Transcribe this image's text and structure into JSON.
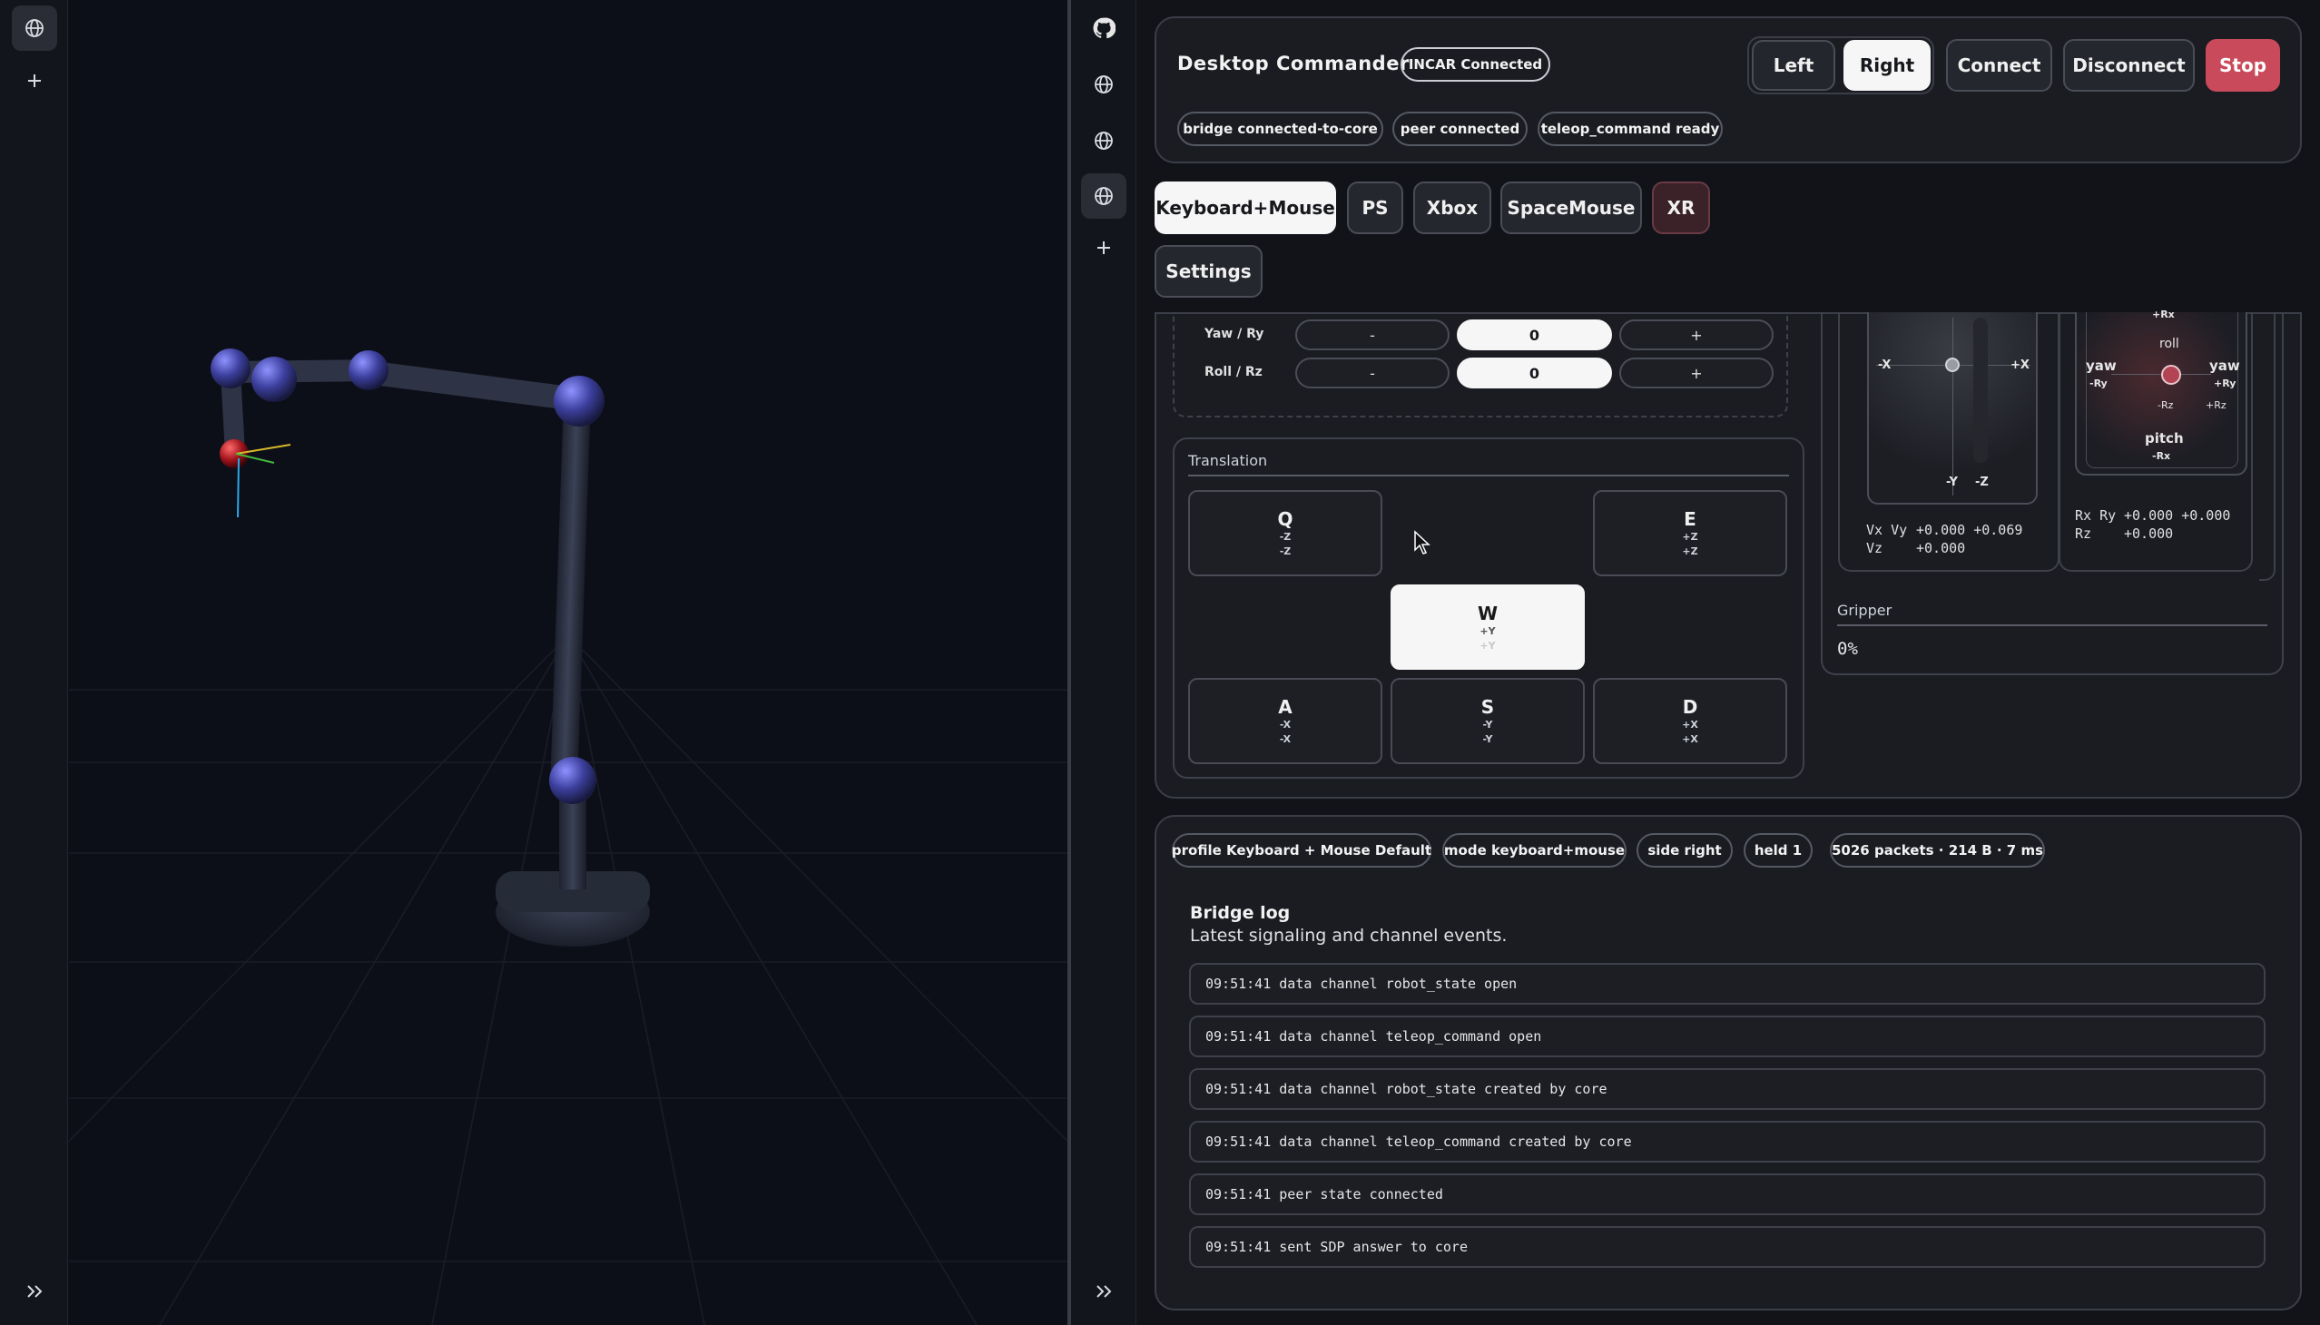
{
  "app": {
    "title": "Desktop Commander",
    "connection_badge": "INCAR Connected",
    "status_chips": [
      "bridge connected-to-core",
      "peer connected",
      "teleop_command ready"
    ]
  },
  "side_toggle": {
    "left": "Left",
    "right": "Right",
    "selected": "Right"
  },
  "actions": {
    "connect": "Connect",
    "disconnect": "Disconnect",
    "stop": "Stop"
  },
  "modes": {
    "keyboard": "Keyboard+Mouse",
    "ps": "PS",
    "xbox": "Xbox",
    "spacemouse": "SpaceMouse",
    "xr": "XR",
    "settings": "Settings",
    "selected": "Keyboard+Mouse"
  },
  "rotation": {
    "rows": [
      {
        "label": "Yaw / Ry",
        "minus": "-",
        "value": "0",
        "plus": "+"
      },
      {
        "label": "Roll / Rz",
        "minus": "-",
        "value": "0",
        "plus": "+"
      }
    ]
  },
  "translation": {
    "title": "Translation",
    "keys": {
      "q": {
        "key": "Q",
        "l1": "-Z",
        "l2": "-Z"
      },
      "e": {
        "key": "E",
        "l1": "+Z",
        "l2": "+Z"
      },
      "w": {
        "key": "W",
        "l1": "+Y",
        "l2": "+Y",
        "pressed": true
      },
      "a": {
        "key": "A",
        "l1": "-X",
        "l2": "-X"
      },
      "s": {
        "key": "S",
        "l1": "-Y",
        "l2": "-Y"
      },
      "d": {
        "key": "D",
        "l1": "+X",
        "l2": "+X"
      }
    }
  },
  "stick_left": {
    "neg_x": "-X",
    "pos_x": "+X",
    "neg_y": "-Y",
    "neg_z": "-Z",
    "v_label1": "Vx Vy",
    "v_vals1": "+0.000 +0.069",
    "v_label2": "Vz",
    "v_vals2": "+0.000"
  },
  "stick_right": {
    "top": "+Rx",
    "roll": "roll",
    "yaw_l": "yaw",
    "yaw_l_sub": "-Ry",
    "yaw_r": "yaw",
    "yaw_r_sub": "+Ry",
    "rz_neg": "-Rz",
    "rz_pos": "+Rz",
    "pitch": "pitch",
    "pitch_sub": "-Rx",
    "r_label1": "Rx Ry",
    "r_vals1": "+0.000 +0.000",
    "r_label2": "Rz",
    "r_vals2": "+0.000"
  },
  "gripper": {
    "title": "Gripper",
    "value": "0%"
  },
  "status_bar": [
    "profile Keyboard + Mouse Default",
    "mode keyboard+mouse",
    "side right",
    "held 1",
    "5026 packets · 214 B · 7 ms"
  ],
  "bridge_log": {
    "title": "Bridge log",
    "subtitle": "Latest signaling and channel events.",
    "entries": [
      "09:51:41 data channel robot_state open",
      "09:51:41 data channel teleop_command open",
      "09:51:41 data channel robot_state created by core",
      "09:51:41 data channel teleop_command created by core",
      "09:51:41 peer state connected",
      "09:51:41 sent SDP answer to core"
    ]
  },
  "icons": [
    "globe-icon",
    "plus-icon",
    "github-icon",
    "expand-icon",
    "cursor-icon"
  ],
  "colors": {
    "stop": "#c94a5a",
    "joint": "#4b4fb0",
    "effector": "#c0202a",
    "panel_bg": "#1a1c22"
  }
}
